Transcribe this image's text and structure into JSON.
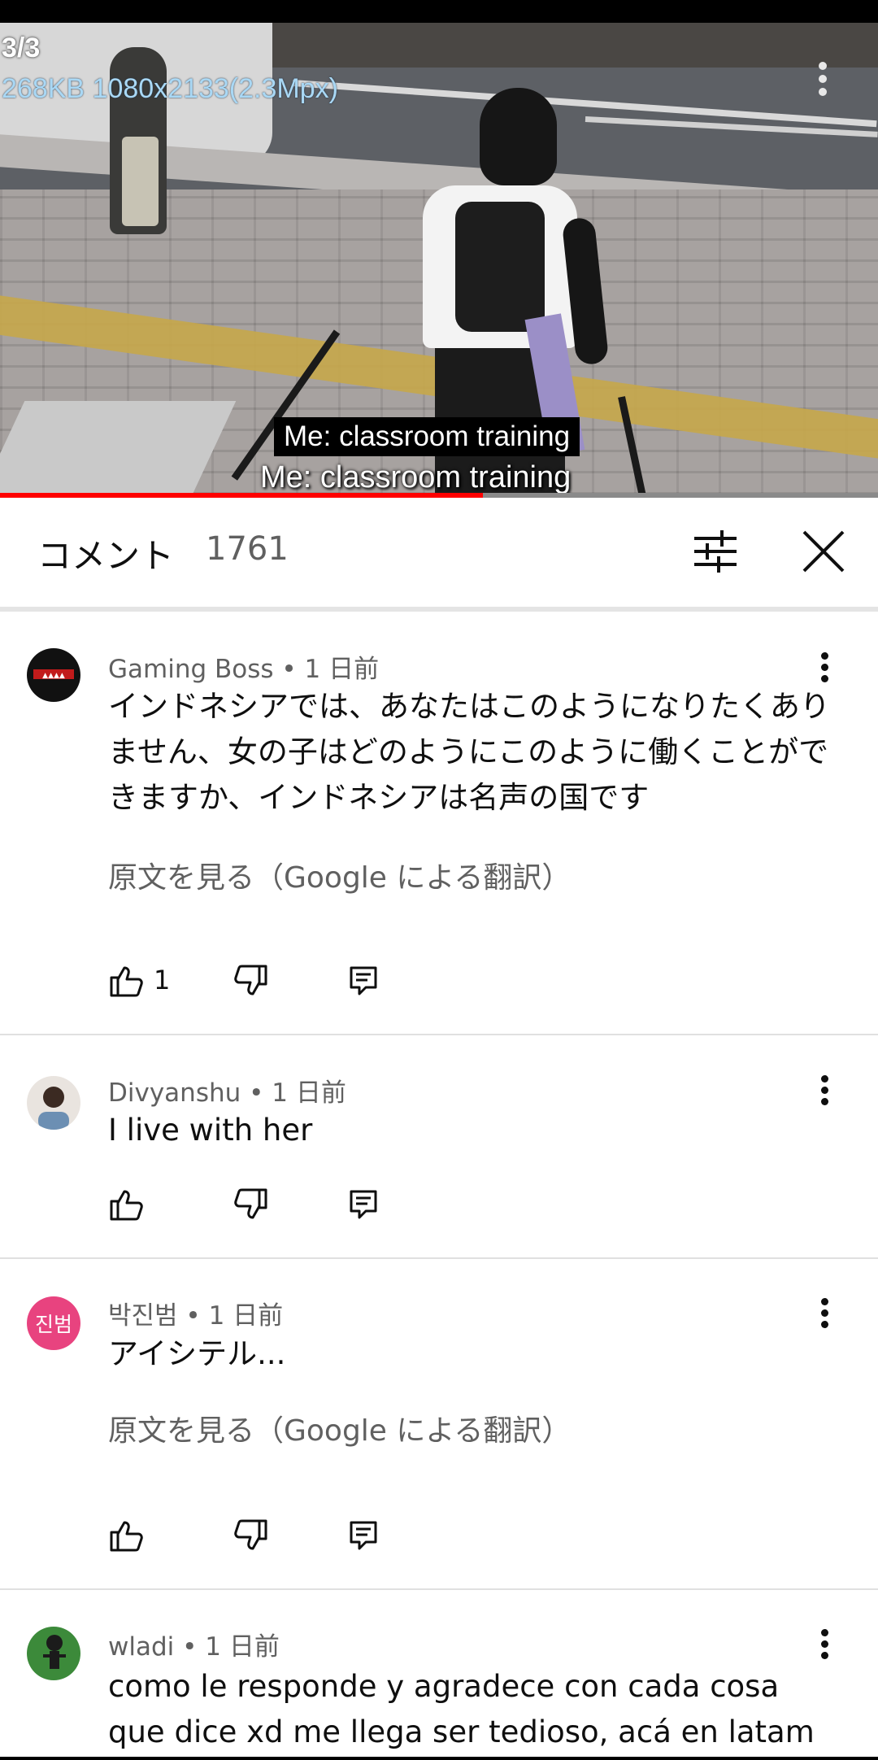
{
  "viewer": {
    "counter": "3/3",
    "info": "268KB 1080x2133(2.3Mpx)",
    "menu_icon": "vertical-dots-icon"
  },
  "video": {
    "caption_box": "Me: classroom training",
    "caption_burned": "Me: classroom training",
    "progress_fraction": 0.55
  },
  "comments_panel": {
    "title": "コメント",
    "count": "1761",
    "filter_icon": "sliders-icon",
    "close_icon": "close-icon"
  },
  "comments": [
    {
      "author": "Gaming Boss",
      "age": "1 日前",
      "text": "インドネシアでは、あなたはこのようになりたくありません、女の子はどのようにこのように働くことができますか、インドネシアは名声の国です",
      "translate_link": "原文を見る（Google による翻訳）",
      "likes": "1",
      "avatar_color": "#111111"
    },
    {
      "author": "Divyanshu",
      "age": "1 日前",
      "text": "I live with her",
      "translate_link": "",
      "likes": "",
      "avatar_color": "#e9e4df"
    },
    {
      "author": "박진범",
      "age": "1 日前",
      "text": "アイシテル...",
      "translate_link": "原文を見る（Google による翻訳）",
      "likes": "",
      "avatar_text": "진범",
      "avatar_color": "#e8437f"
    },
    {
      "author": "wladi",
      "age": "1 日前",
      "text": "como le responde y agradece con cada cosa que dice xd me llega ser tedioso, acá en latam",
      "translate_link": "",
      "likes": "",
      "avatar_color": "#3c8a3a"
    }
  ]
}
